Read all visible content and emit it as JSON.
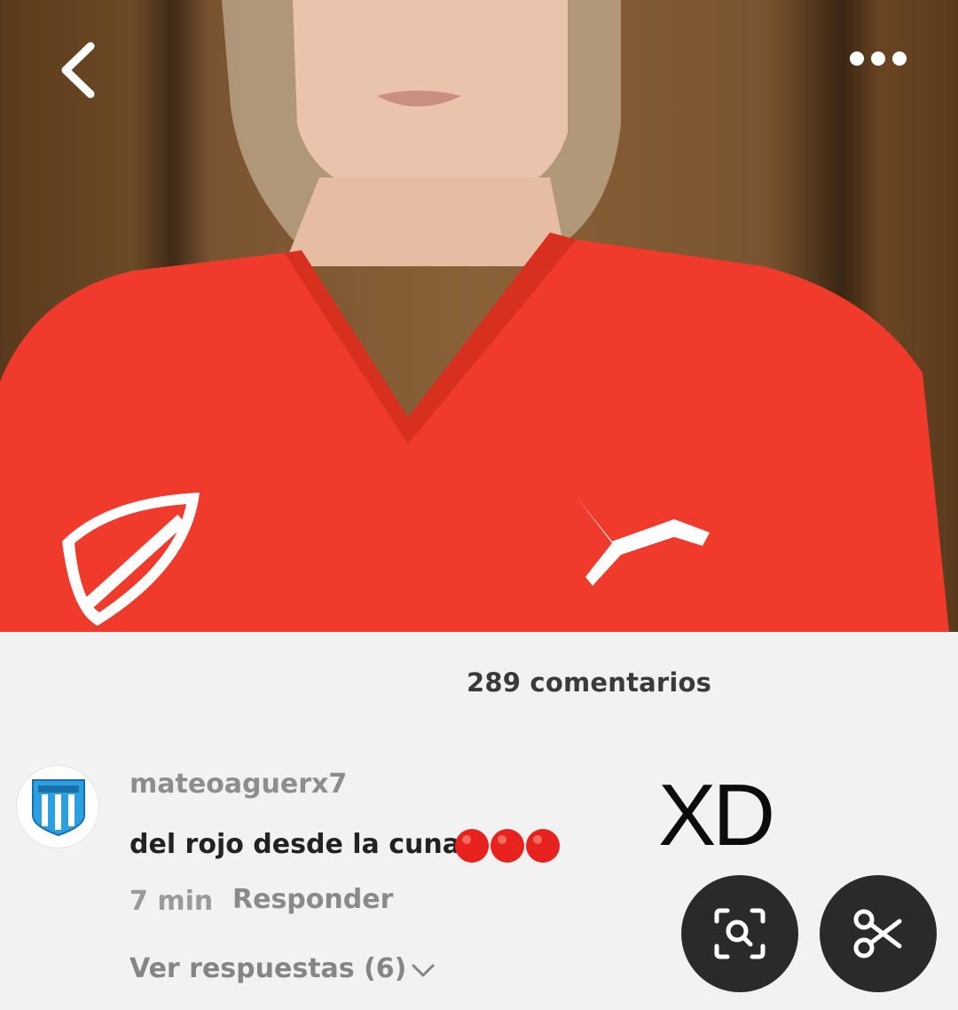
{
  "comments": {
    "count_label": "289 comentarios",
    "items": [
      {
        "username": "mateoaguerx7",
        "text": "del rojo desde la cuna",
        "emoji": "🔴🔴🔴",
        "time": "7 min",
        "reply_label": "Responder",
        "view_replies_label": "Ver respuestas (6)"
      }
    ]
  },
  "overlay_text": "XD",
  "icons": {
    "back": "chevron-left-icon",
    "more": "more-horizontal-icon",
    "lens": "lens-search-icon",
    "cut": "scissors-icon"
  },
  "colors": {
    "jersey_red": "#ef3a2c",
    "panel_bg": "#f2f2f3",
    "fab_bg": "#2a2a2a"
  }
}
